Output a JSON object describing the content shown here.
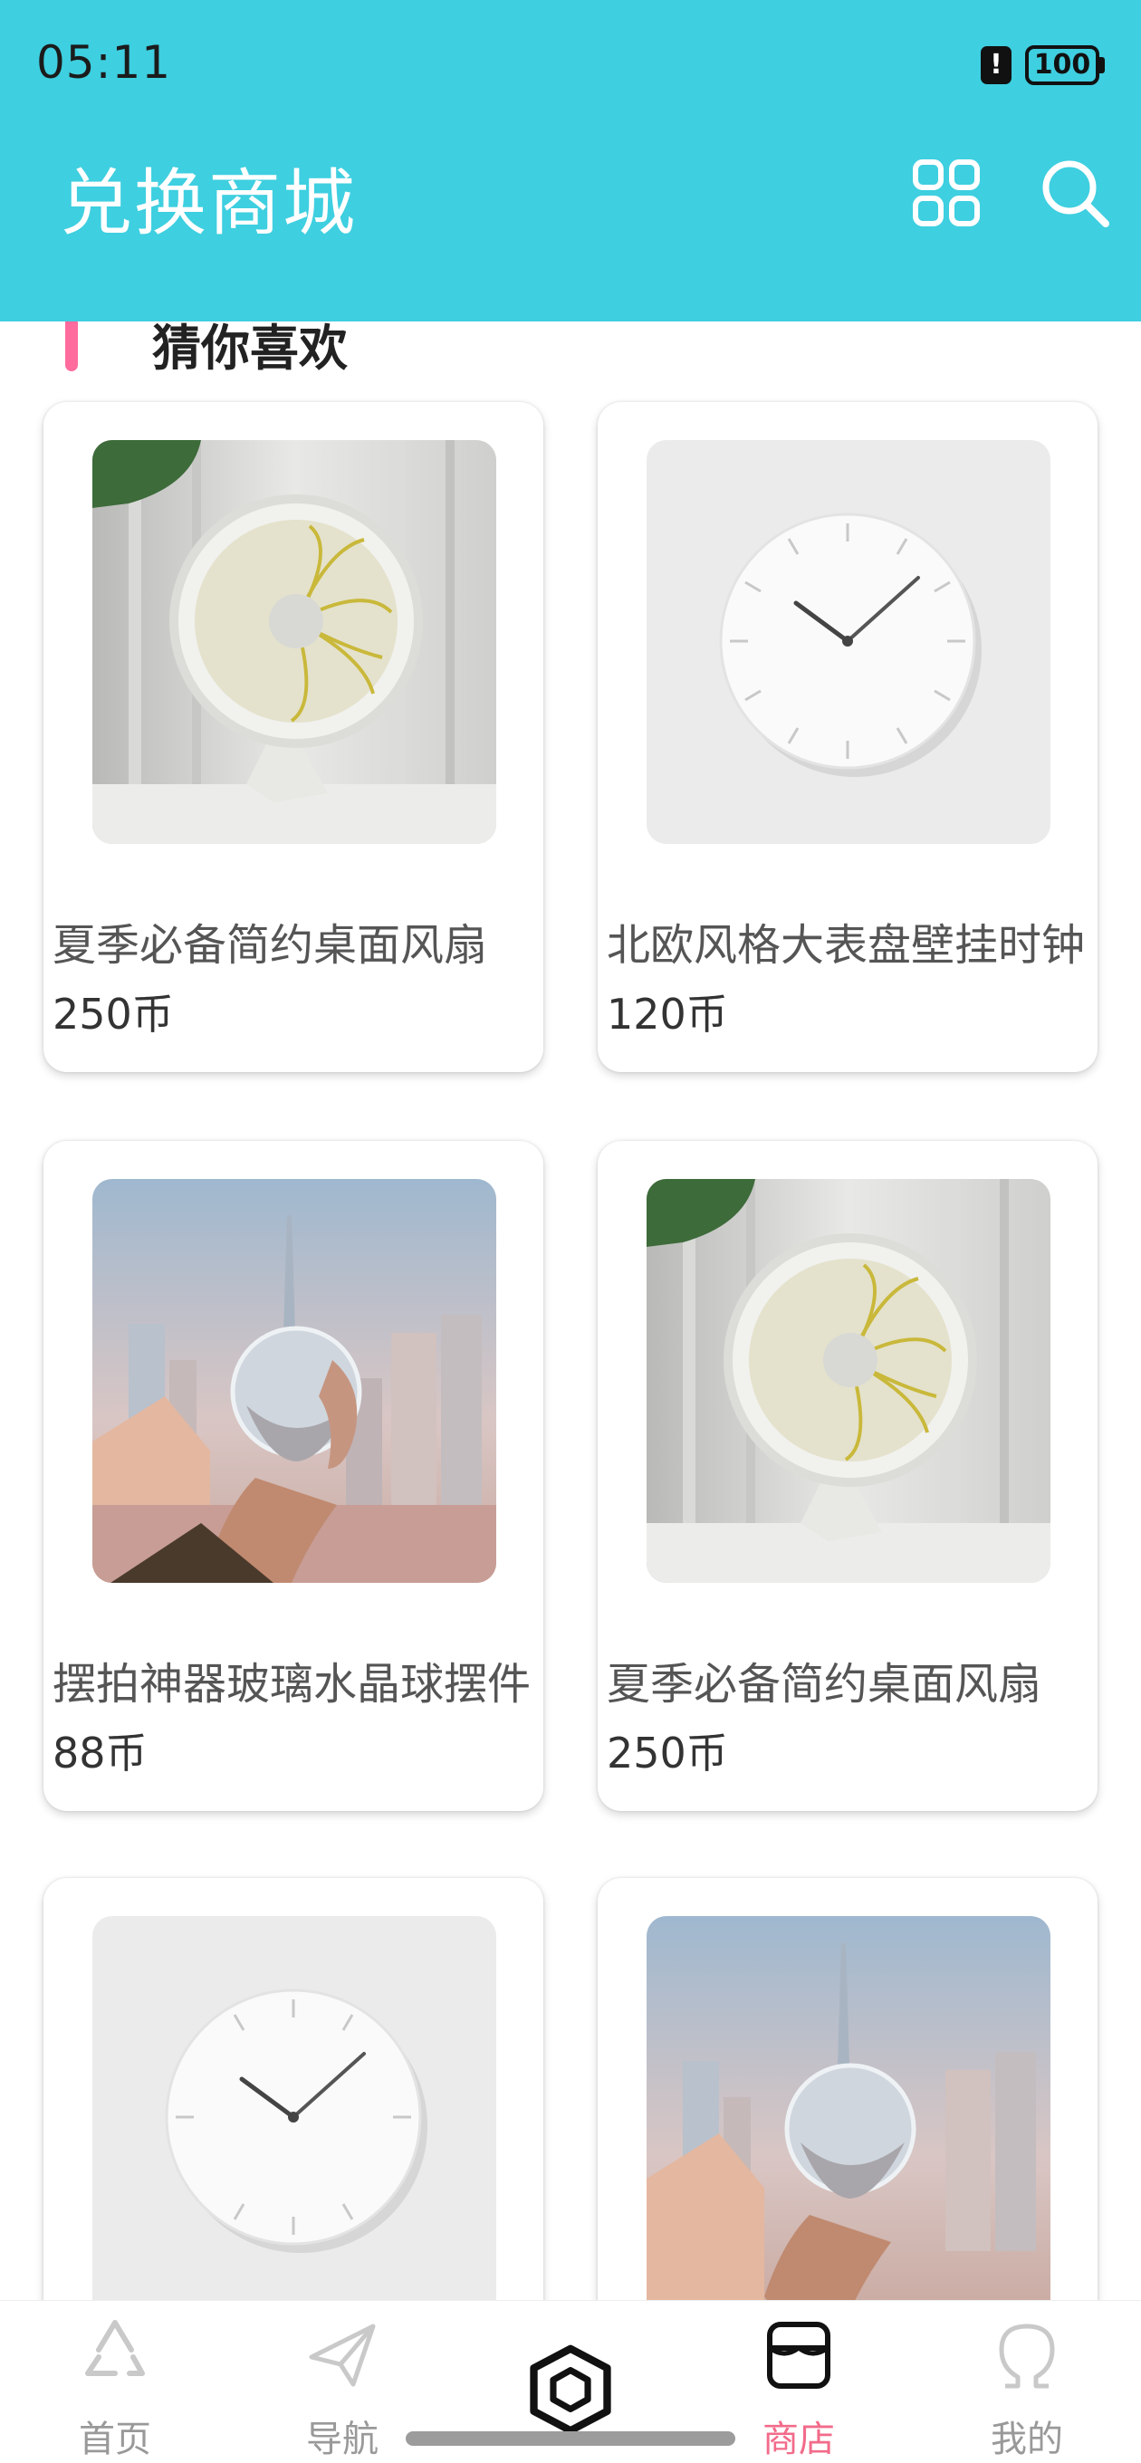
{
  "status_bar": {
    "time": "05:11",
    "alert_icon": "!",
    "battery": "100"
  },
  "header": {
    "title": "兑换商城",
    "background_color": "#3ecfe0",
    "grid_icon": "grid-icon",
    "search_icon": "search-icon"
  },
  "section": {
    "title": "猜你喜欢",
    "accent_color": "#ff6b9d"
  },
  "products": [
    {
      "name": "夏季必备简约桌面风扇",
      "price": "250币",
      "image": "desk-fan"
    },
    {
      "name": "北欧风格大表盘壁挂时钟",
      "price": "120币",
      "image": "wall-clock"
    },
    {
      "name": "摆拍神器玻璃水晶球摆件",
      "price": "88币",
      "image": "crystal-ball"
    },
    {
      "name": "夏季必备简约桌面风扇",
      "price": "250币",
      "image": "desk-fan"
    },
    {
      "name": "",
      "price": "",
      "image": "wall-clock"
    },
    {
      "name": "",
      "price": "",
      "image": "crystal-ball"
    }
  ],
  "bottom_nav": {
    "items": [
      {
        "label": "首页",
        "icon": "home-recycle-icon",
        "active": false
      },
      {
        "label": "导航",
        "icon": "paper-plane-icon",
        "active": false
      },
      {
        "label": "",
        "icon": "hexagon-center-icon",
        "active": false
      },
      {
        "label": "商店",
        "icon": "store-icon",
        "active": true
      },
      {
        "label": "我的",
        "icon": "omega-profile-icon",
        "active": false
      }
    ],
    "active_color": "#f26b8a"
  }
}
